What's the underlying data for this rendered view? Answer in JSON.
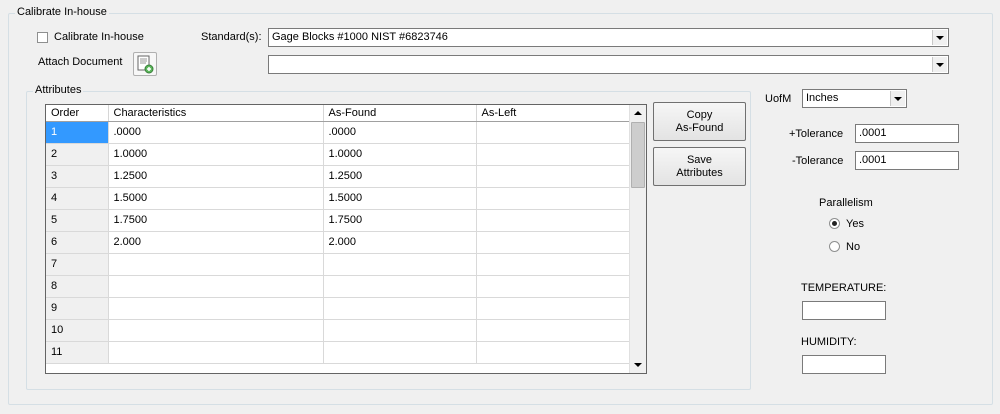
{
  "section_title": "Calibrate In-house",
  "calibrate_checkbox": {
    "label": "Calibrate In-house",
    "checked": false
  },
  "standards": {
    "label": "Standard(s):",
    "value": "Gage Blocks #1000 NIST #6823746"
  },
  "attach": {
    "label": "Attach Document",
    "icon": "attach-document-icon",
    "value": ""
  },
  "attributes": {
    "title": "Attributes",
    "columns": [
      "Order",
      "Characteristics",
      "As-Found",
      "As-Left"
    ],
    "rows": [
      {
        "order": "1",
        "characteristics": ".0000",
        "as_found": ".0000",
        "as_left": ""
      },
      {
        "order": "2",
        "characteristics": "1.0000",
        "as_found": "1.0000",
        "as_left": ""
      },
      {
        "order": "3",
        "characteristics": "1.2500",
        "as_found": "1.2500",
        "as_left": ""
      },
      {
        "order": "4",
        "characteristics": "1.5000",
        "as_found": "1.5000",
        "as_left": ""
      },
      {
        "order": "5",
        "characteristics": "1.7500",
        "as_found": "1.7500",
        "as_left": ""
      },
      {
        "order": "6",
        "characteristics": "2.000",
        "as_found": "2.000",
        "as_left": ""
      },
      {
        "order": "7",
        "characteristics": "",
        "as_found": "",
        "as_left": ""
      },
      {
        "order": "8",
        "characteristics": "",
        "as_found": "",
        "as_left": ""
      },
      {
        "order": "9",
        "characteristics": "",
        "as_found": "",
        "as_left": ""
      },
      {
        "order": "10",
        "characteristics": "",
        "as_found": "",
        "as_left": ""
      },
      {
        "order": "11",
        "characteristics": "",
        "as_found": "",
        "as_left": ""
      }
    ],
    "copy_button": "Copy\nAs-Found",
    "save_button": "Save\nAttributes"
  },
  "uofm": {
    "label": "UofM",
    "value": "Inches"
  },
  "plus_tolerance": {
    "label": "+Tolerance",
    "value": ".0001"
  },
  "minus_tolerance": {
    "label": "-Tolerance",
    "value": ".0001"
  },
  "parallelism": {
    "label": "Parallelism",
    "options": [
      "Yes",
      "No"
    ],
    "selected": "Yes"
  },
  "temperature": {
    "label": "TEMPERATURE:",
    "value": ""
  },
  "humidity": {
    "label": "HUMIDITY:",
    "value": ""
  },
  "colors": {
    "selection": "#3399ff",
    "background": "#f0f0f0"
  }
}
